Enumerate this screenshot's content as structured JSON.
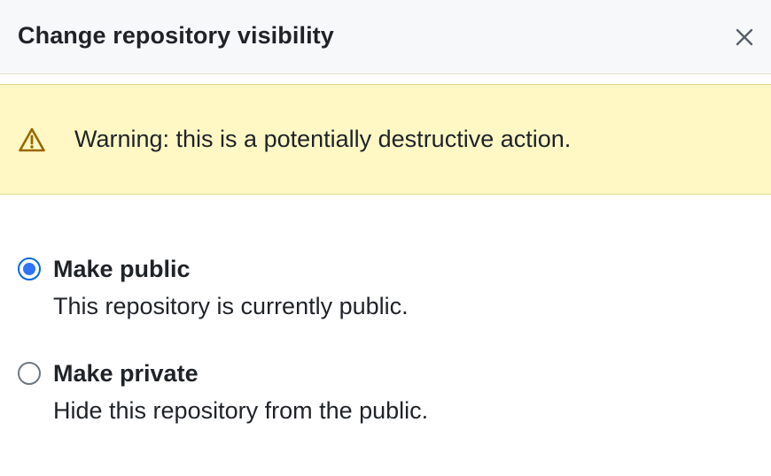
{
  "dialog": {
    "title": "Change repository visibility",
    "close_icon": "close-icon"
  },
  "warning": {
    "icon": "alert-triangle-icon",
    "text": "Warning: this is a potentially destructive action.",
    "background_color": "#fff8c5",
    "icon_color": "#9a6700"
  },
  "options": [
    {
      "label": "Make public",
      "description": "This repository is currently public.",
      "selected": true
    },
    {
      "label": "Make private",
      "description": "Hide this repository from the public.",
      "selected": false
    }
  ],
  "colors": {
    "accent": "#0969da",
    "header_bg": "#f6f8fa",
    "text": "#1f2328"
  }
}
